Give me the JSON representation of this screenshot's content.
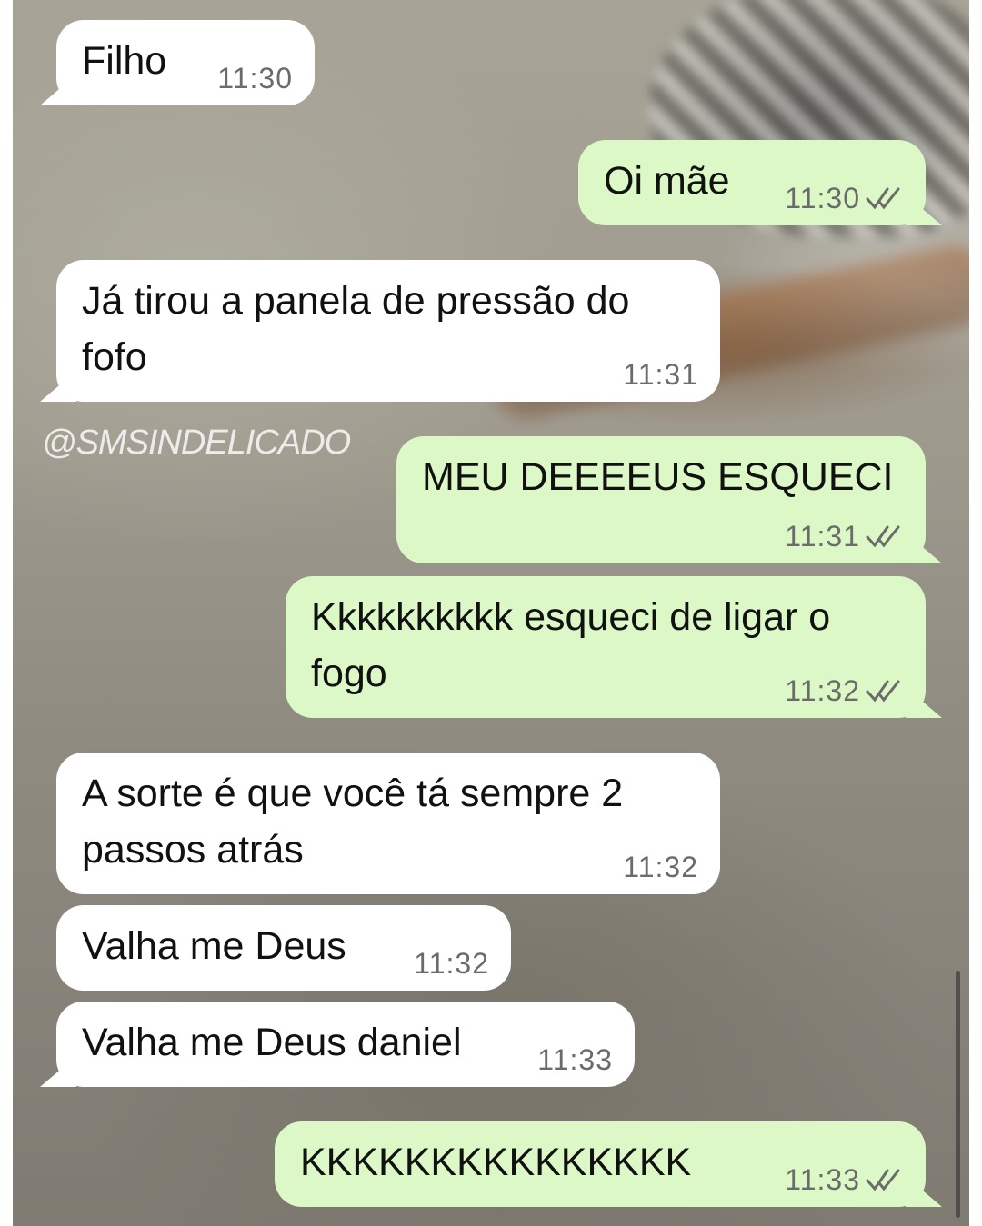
{
  "watermark": "@SMSINDELICADO",
  "messages": [
    {
      "direction": "in",
      "text": "Filho",
      "time": "11:30"
    },
    {
      "direction": "out",
      "text": "Oi mãe",
      "time": "11:30",
      "status": "read"
    },
    {
      "direction": "in",
      "text": "Já tirou a panela de pressão do fofo",
      "time": "11:31"
    },
    {
      "direction": "out",
      "text": "MEU DEEEEUS ESQUECI",
      "time": "11:31",
      "status": "read"
    },
    {
      "direction": "out",
      "text": "Kkkkkkkkkk esqueci de ligar o fogo",
      "time": "11:32",
      "status": "read"
    },
    {
      "direction": "in",
      "text": "A sorte é que você tá sempre 2 passos atrás",
      "time": "11:32"
    },
    {
      "direction": "in",
      "text": "Valha me Deus",
      "time": "11:32"
    },
    {
      "direction": "in",
      "text": "Valha me Deus daniel",
      "time": "11:33"
    },
    {
      "direction": "out",
      "text": "KKKKKKKKKKKKKKK",
      "time": "11:33",
      "status": "read"
    }
  ],
  "colors": {
    "incoming_bubble": "#ffffff",
    "outgoing_bubble": "#dbf8c6",
    "timestamp": "#6b6b6b"
  },
  "icons": {
    "read_receipt": "double-check-icon"
  }
}
